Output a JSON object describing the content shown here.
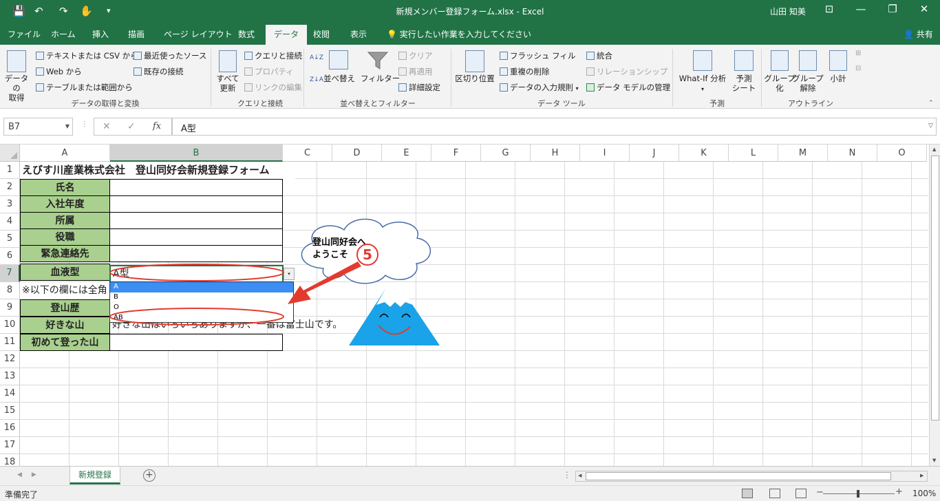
{
  "window": {
    "title": "新規メンバー登録フォーム.xlsx  -  Excel",
    "user": "山田 知美",
    "qa_save": "💾",
    "qa_undo": "↶",
    "qa_redo": "↷",
    "qa_touch": "✋",
    "qa_more": "▾",
    "ctrl_ribbon": "⊡",
    "ctrl_min": "—",
    "ctrl_max": "❐",
    "ctrl_close": "✕"
  },
  "tabs": [
    "ファイル",
    "ホーム",
    "挿入",
    "描画",
    "ページ レイアウト",
    "数式",
    "データ",
    "校閲",
    "表示"
  ],
  "active_tab": "データ",
  "tell_me": "実行したい作業を入力してください",
  "share": "共有",
  "ribbon": {
    "get_data": "データの\n取得",
    "text_csv": "テキストまたは CSV から",
    "web": "Web から",
    "table_range": "テーブルまたは範囲から",
    "recent_sources": "最近使ったソース",
    "existing_conn": "既存の接続",
    "group_get": "データの取得と変換",
    "refresh_all": "すべて\n更新",
    "queries_conn": "クエリと接続",
    "properties": "プロパティ",
    "edit_links": "リンクの編集",
    "group_queries": "クエリと接続",
    "sort_az": "A↓Z",
    "sort_za": "Z↓A",
    "sort": "並べ替え",
    "filter": "フィルター",
    "clear": "クリア",
    "reapply": "再適用",
    "advanced": "詳細設定",
    "group_sort": "並べ替えとフィルター",
    "text_to_columns": "区切り位置",
    "flash_fill": "フラッシュ フィル",
    "remove_dup": "重複の削除",
    "data_validation": "データの入力規則",
    "consolidate": "統合",
    "relationships": "リレーションシップ",
    "data_model": "データ モデルの管理",
    "group_tools": "データ ツール",
    "whatif": "What-If 分析",
    "forecast_sheet": "予測\nシート",
    "group_forecast": "予測",
    "group_btn": "グループ\n化",
    "ungroup_btn": "グループ\n解除",
    "subtotal": "小計",
    "group_outline": "アウトライン"
  },
  "formula_bar": {
    "name_box": "B7",
    "cancel": "✕",
    "enter": "✓",
    "fx": "fx",
    "formula": "A型"
  },
  "columns": [
    "A",
    "B",
    "C",
    "D",
    "E",
    "F",
    "G",
    "H",
    "I",
    "J",
    "K",
    "L",
    "M",
    "N",
    "O"
  ],
  "selected_column": "B",
  "rows": [
    "1",
    "2",
    "3",
    "4",
    "5",
    "6",
    "7",
    "8",
    "9",
    "10",
    "11",
    "12",
    "13",
    "14",
    "15",
    "16",
    "17",
    "18"
  ],
  "selected_row": "7",
  "cells": {
    "a1": "えびす川産業株式会社　登山同好会新規登録フォーム",
    "a2": "氏名",
    "a3": "入社年度",
    "a4": "所属",
    "a5": "役職",
    "a6": "緊急連絡先",
    "a7": "血液型",
    "a8": "※以下の欄には全角",
    "a9": "登山歴",
    "a10": "好きな山",
    "a11": "初めて登った山",
    "b7": "A型",
    "b10": "好きな山はいろいろありますが、一番は富士山です。"
  },
  "dropdown": {
    "options": [
      "A",
      "B",
      "O",
      "AB"
    ],
    "highlighted": "A",
    "button": "▾"
  },
  "callout": {
    "text_line1": "登山同好会へ",
    "text_line2": "ようこそ",
    "step_badge": "5"
  },
  "sheet_tab": "新規登録",
  "add_sheet": "+",
  "status": {
    "ready": "準備完了",
    "zoom": "100%"
  },
  "colors": {
    "excel_green": "#217346",
    "label_fill": "#a9d08e",
    "annotation_red": "#e23b2e",
    "dropdown_highlight": "#3b8ef3",
    "mountain_blue": "#1aa3e8"
  }
}
